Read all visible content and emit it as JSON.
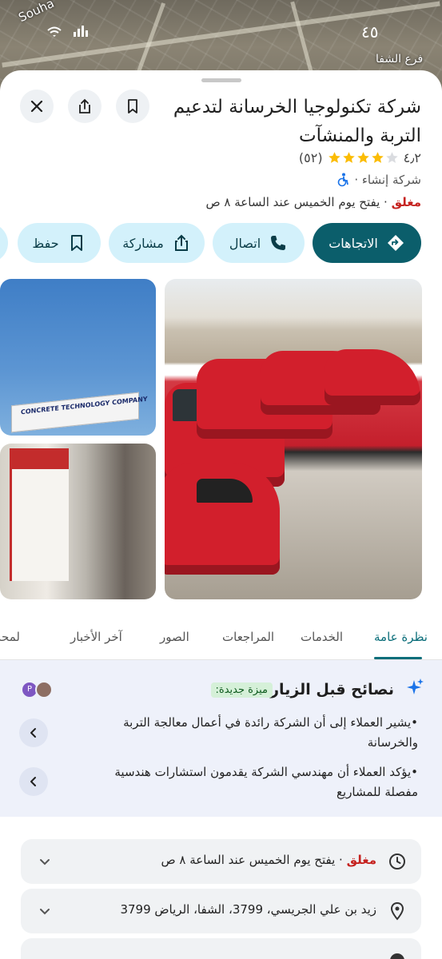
{
  "status_bar": {
    "time": "٤٥",
    "icons": "wifi signal"
  },
  "map": {
    "label_left": "Souha",
    "label_right": "فرع الشفا"
  },
  "place": {
    "name": "شركة تكنولوجيا الخرسانة لتدعيم التربة والمنشآت",
    "rating": "٤٫٢",
    "stars_filled": 4,
    "stars_total": 5,
    "review_count": "(٥٢)",
    "category": "شركة إنشاء ·",
    "status": "مغلق",
    "opens": "· يفتح يوم الخميس عند الساعة ٨ ص"
  },
  "actions": {
    "directions": "الاتجاهات",
    "call": "اتصال",
    "share": "مشاركة",
    "save": "حفظ"
  },
  "photos": {
    "sign_text": "CONCRETE TECHNOLOGY COMPANY"
  },
  "tabs": [
    "نظرة عامة",
    "الخدمات",
    "المراجعات",
    "الصور",
    "آخر الأخبار",
    "لمحة"
  ],
  "tips": {
    "title": "نصائح قبل الزيارة",
    "badge": "ميزة جديدة:",
    "avatar_letter": "P",
    "items": [
      "•يشير العملاء إلى أن الشركة رائدة في أعمال معالجة التربة والخرسانة",
      "•يؤكد العملاء أن مهندسي الشركة يقدمون استشارات هندسية مفصلة للمشاريع"
    ]
  },
  "info": {
    "hours_status": "مغلق",
    "hours_text": "· يفتح يوم الخميس عند الساعة ٨ ص",
    "address": "زيد بن علي الجريسي، 3799، الشفا، الرياض 3799"
  },
  "colors": {
    "accent": "#0b5e6b",
    "chip_bg": "#d3f1fb",
    "closed": "#c5221f"
  }
}
